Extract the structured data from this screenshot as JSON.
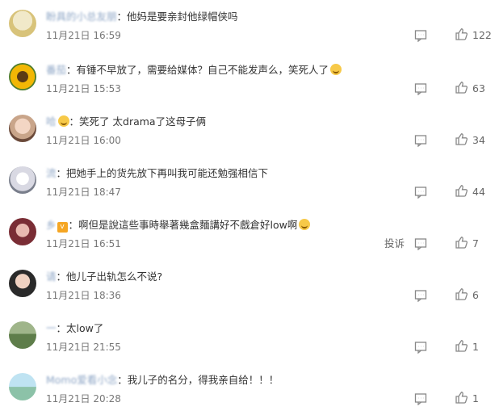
{
  "comments": [
    {
      "user": "盼具的小总友朋",
      "text": "他妈是要亲封他绿帽侠吗",
      "time": "11月21日 16:59",
      "likes": "122"
    },
    {
      "user": "番茄",
      "text": "有锤不早放了，需要给媒体？自己不能发声么，笑死人了",
      "time": "11月21日 15:53",
      "likes": "63"
    },
    {
      "user": "哈",
      "text": "笑死了 太drama了这母子俩",
      "time": "11月21日 16:00",
      "likes": "34"
    },
    {
      "user": "流",
      "text": "把她手上的货先放下再叫我可能还勉强相信下",
      "time": "11月21日 18:47",
      "likes": "44"
    },
    {
      "user": "乡",
      "text": "啊但是說這些事時舉著幾盒麵講好不戲倉好low啊",
      "time": "11月21日 16:51",
      "likes": "7",
      "report": "投诉"
    },
    {
      "user": "请",
      "text": "他儿子出轨怎么不说?",
      "time": "11月21日 18:36",
      "likes": "6"
    },
    {
      "user": "一",
      "text": "太low了",
      "time": "11月21日 21:55",
      "likes": "1"
    },
    {
      "user": "Momo爱看小念",
      "text": "我儿子的名分，得我亲自给！！！",
      "time": "11月21日 20:28",
      "likes": "1"
    }
  ],
  "icons": {
    "reply": "comment-icon",
    "like": "thumbs-up-icon",
    "mood": "laughing-emoji-icon",
    "vip": "vip-badge-icon"
  },
  "colors": {
    "username": "#4f7fbf",
    "time": "#777777",
    "icon": "#888888"
  }
}
